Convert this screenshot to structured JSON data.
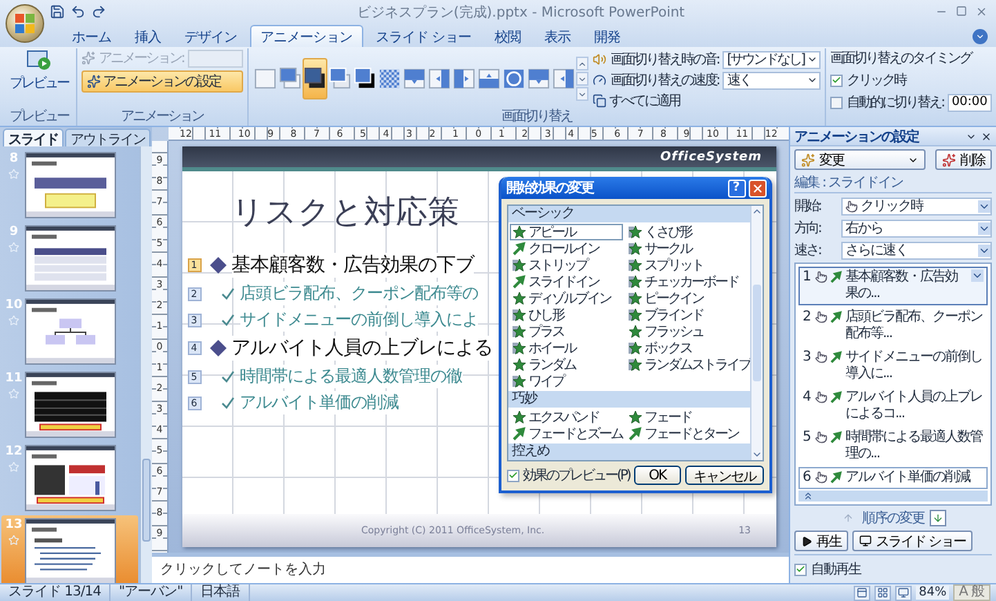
{
  "window": {
    "title": "ビジネスプラン(完成).pptx - Microsoft PowerPoint"
  },
  "ribbon_tabs": [
    {
      "label": "ホーム",
      "selected": false
    },
    {
      "label": "挿入",
      "selected": false
    },
    {
      "label": "デザイン",
      "selected": false
    },
    {
      "label": "アニメーション",
      "selected": true
    },
    {
      "label": "スライド ショー",
      "selected": false
    },
    {
      "label": "校閲",
      "selected": false
    },
    {
      "label": "表示",
      "selected": false
    },
    {
      "label": "開発",
      "selected": false
    }
  ],
  "ribbon": {
    "preview_group": {
      "button": "プレビュー",
      "label": "プレビュー"
    },
    "animation_group": {
      "label": "アニメーション",
      "animation_field": {
        "label": "アニメーション:",
        "disabled": true
      },
      "custom_button": {
        "label": "アニメーションの設定",
        "selected": true
      }
    },
    "transition_group": {
      "label": "画面切り替え",
      "gallery": [
        {
          "kind": "plain",
          "selected": false
        },
        {
          "kind": "stack",
          "selected": false
        },
        {
          "kind": "dark-stack",
          "selected": true
        },
        {
          "kind": "shadow",
          "selected": false
        },
        {
          "kind": "black-shadow",
          "selected": false
        },
        {
          "kind": "checker",
          "selected": false
        },
        {
          "kind": "wipe-down",
          "selected": false
        },
        {
          "kind": "wipe-left",
          "selected": false
        },
        {
          "kind": "wipe-right",
          "selected": false
        },
        {
          "kind": "wipe-up",
          "selected": false
        },
        {
          "kind": "circle",
          "selected": false
        },
        {
          "kind": "wipe-down",
          "selected": false
        },
        {
          "kind": "wipe-left",
          "selected": false
        }
      ],
      "sound": {
        "label": "画面切り替え時の音:",
        "value": "[サウンドなし]"
      },
      "speed": {
        "label": "画面切り替えの速度:",
        "value": "速く"
      },
      "apply_all": "すべてに適用"
    },
    "timing_group": {
      "title": "画面切り替えのタイミング",
      "on_click": {
        "label": "クリック時",
        "checked": true
      },
      "auto": {
        "label": "自動的に切り替え:",
        "checked": false,
        "value": "00:00"
      }
    }
  },
  "slides_panel": {
    "tabs": [
      {
        "label": "スライド",
        "selected": true
      },
      {
        "label": "アウトライン",
        "selected": false
      }
    ],
    "slides": [
      {
        "number": "8",
        "kind": "process",
        "selected": false
      },
      {
        "number": "9",
        "kind": "table",
        "selected": false
      },
      {
        "number": "10",
        "kind": "org",
        "selected": false
      },
      {
        "number": "11",
        "kind": "dark-table",
        "selected": false
      },
      {
        "number": "12",
        "kind": "chart",
        "selected": false
      },
      {
        "number": "13",
        "kind": "bullets",
        "selected": true
      }
    ]
  },
  "rulers": {
    "horizontal": [
      "12",
      "11",
      "10",
      "9",
      "8",
      "7",
      "6",
      "5",
      "4",
      "3",
      "2",
      "1",
      "0",
      "1",
      "2",
      "3",
      "4",
      "5",
      "6",
      "7",
      "8",
      "9",
      "10",
      "11",
      "12"
    ],
    "vertical": [
      "9",
      "8",
      "7",
      "6",
      "5",
      "4",
      "3",
      "2",
      "1",
      "0",
      "1",
      "2",
      "3",
      "4",
      "5",
      "6",
      "7",
      "8",
      "9"
    ]
  },
  "slide": {
    "logo": "OfficeSystem",
    "title": "リスクと対応策",
    "bullets": [
      {
        "text": "基本顧客数・広告効果の下ブ",
        "tag": "1",
        "selected": true,
        "children": [
          {
            "text": "店頭ビラ配布、クーポン配布等の",
            "tag": "2",
            "selected": false
          },
          {
            "text": "サイドメニューの前倒し導入によ",
            "tag": "3",
            "selected": false
          }
        ]
      },
      {
        "text": "アルバイト人員の上ブレによる",
        "tag": "4",
        "selected": false,
        "children": [
          {
            "text": "時間帯による最適人数管理の徹",
            "tag": "5",
            "selected": false
          },
          {
            "text": "アルバイト単価の削減",
            "tag": "6",
            "selected": false
          }
        ]
      }
    ],
    "footer": "Copyright (C) 2011 OfficeSystem, Inc.",
    "page": "13"
  },
  "dialog": {
    "title": "開始効果の変更",
    "help": "?",
    "sections": [
      {
        "heading": "ベーシック",
        "effects": [
          {
            "label": "アピール",
            "kind": "star",
            "selected": true
          },
          {
            "label": "くさび形",
            "kind": "sweep",
            "selected": false
          },
          {
            "label": "クロールイン",
            "kind": "arrow",
            "selected": false
          },
          {
            "label": "サークル",
            "kind": "sweep",
            "selected": false
          },
          {
            "label": "ストリップ",
            "kind": "sweep",
            "selected": false
          },
          {
            "label": "スプリット",
            "kind": "sweep",
            "selected": false
          },
          {
            "label": "スライドイン",
            "kind": "arrow",
            "selected": false
          },
          {
            "label": "チェッカーボード",
            "kind": "sweep",
            "selected": false
          },
          {
            "label": "ディゾルブイン",
            "kind": "star",
            "selected": false
          },
          {
            "label": "ピークイン",
            "kind": "sweep",
            "selected": false
          },
          {
            "label": "ひし形",
            "kind": "sweep",
            "selected": false
          },
          {
            "label": "ブラインド",
            "kind": "sweep",
            "selected": false
          },
          {
            "label": "プラス",
            "kind": "sweep",
            "selected": false
          },
          {
            "label": "フラッシュ",
            "kind": "star",
            "selected": false
          },
          {
            "label": "ホイール",
            "kind": "sweep",
            "selected": false
          },
          {
            "label": "ボックス",
            "kind": "sweep",
            "selected": false
          },
          {
            "label": "ランダム",
            "kind": "star",
            "selected": false
          },
          {
            "label": "ランダムストライプ",
            "kind": "sweep",
            "selected": false
          },
          {
            "label": "ワイプ",
            "kind": "sweep",
            "selected": false
          }
        ]
      },
      {
        "heading": "巧妙",
        "effects": [
          {
            "label": "エクスパンド",
            "kind": "star",
            "selected": false
          },
          {
            "label": "フェード",
            "kind": "star",
            "selected": false
          },
          {
            "label": "フェードとズーム",
            "kind": "arrow",
            "selected": false
          },
          {
            "label": "フェードとターン",
            "kind": "arrow",
            "selected": false
          }
        ]
      },
      {
        "heading": "控えめ"
      }
    ],
    "preview": {
      "label": "効果のプレビュー(P)",
      "checked": true
    },
    "buttons": [
      "OK",
      "キャンセル"
    ]
  },
  "notes": {
    "placeholder": "クリックしてノートを入力"
  },
  "task_pane": {
    "title": "アニメーションの設定",
    "change_button": "変更",
    "remove_button": "削除",
    "edit_label": "編集 : スライドイン",
    "fields": [
      {
        "label": "開始:",
        "value": "クリック時",
        "kind": "start"
      },
      {
        "label": "方向:",
        "value": "右から",
        "kind": "plain"
      },
      {
        "label": "速さ:",
        "value": "さらに速く",
        "kind": "plain"
      }
    ],
    "items": [
      {
        "number": "1",
        "text": "基本顧客数・広告効果の...",
        "selected": true,
        "focused": false
      },
      {
        "number": "2",
        "text": "店頭ビラ配布、クーポン配布等...",
        "selected": false,
        "focused": false
      },
      {
        "number": "3",
        "text": "サイドメニューの前倒し導入に...",
        "selected": false,
        "focused": false
      },
      {
        "number": "4",
        "text": "アルバイト人員の上ブレによるコ...",
        "selected": false,
        "focused": false
      },
      {
        "number": "5",
        "text": "時間帯による最適人数管理の...",
        "selected": false,
        "focused": false
      },
      {
        "number": "6",
        "text": "アルバイト単価の削減",
        "selected": false,
        "focused": true
      }
    ],
    "order_label": "順序の変更",
    "play_button": "再生",
    "slideshow_button": "スライド ショー",
    "autoplay": {
      "label": "自動再生",
      "checked": true
    }
  },
  "status_bar": {
    "slide": "スライド 13/14",
    "theme": "\"アーバン\"",
    "language": "日本語",
    "zoom": "84%",
    "ime_mode": "A",
    "ime_conversion": "般"
  }
}
